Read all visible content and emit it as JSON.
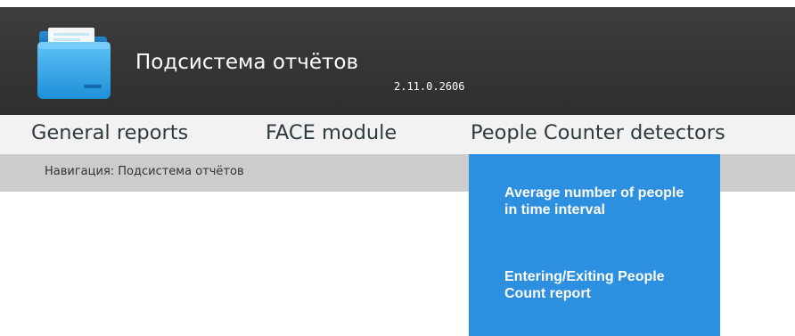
{
  "header": {
    "title": "Подсистема отчётов",
    "version": "2.11.0.2606",
    "logo_icon": "folder-icon"
  },
  "menu": {
    "items": [
      {
        "label": "General reports"
      },
      {
        "label": "FACE module"
      },
      {
        "label": "People Counter detectors"
      }
    ]
  },
  "breadcrumb": {
    "text": "Навигация: Подсистема отчётов"
  },
  "dropdown": {
    "items": [
      {
        "label": "Average number of people in time interval"
      },
      {
        "label": "Entering/Exiting People Count report"
      }
    ]
  },
  "colors": {
    "header_bg": "#353535",
    "menubar_bg": "#f2f2f2",
    "breadcrumb_bg": "#cccccc",
    "dropdown_bg": "#2c8fe0",
    "accent": "#2c8fe0"
  }
}
